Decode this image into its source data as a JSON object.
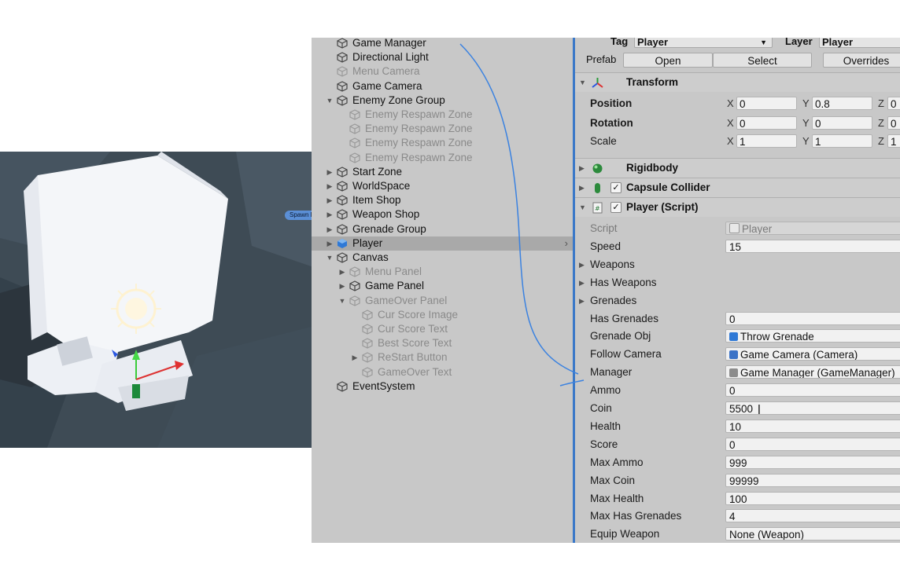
{
  "scene": {
    "spawn_label": "Spawn Po"
  },
  "hierarchy": {
    "items": [
      {
        "label": "Game Manager",
        "depth": 0,
        "arrow": "",
        "active": true
      },
      {
        "label": "Directional Light",
        "depth": 0,
        "arrow": "",
        "active": true
      },
      {
        "label": "Menu Camera",
        "depth": 0,
        "arrow": "",
        "active": false
      },
      {
        "label": "Game Camera",
        "depth": 0,
        "arrow": "",
        "active": true
      },
      {
        "label": "Enemy Zone Group",
        "depth": 0,
        "arrow": "▼",
        "active": true
      },
      {
        "label": "Enemy Respawn Zone",
        "depth": 1,
        "arrow": "",
        "active": false
      },
      {
        "label": "Enemy Respawn Zone",
        "depth": 1,
        "arrow": "",
        "active": false
      },
      {
        "label": "Enemy Respawn Zone",
        "depth": 1,
        "arrow": "",
        "active": false
      },
      {
        "label": "Enemy Respawn Zone",
        "depth": 1,
        "arrow": "",
        "active": false
      },
      {
        "label": "Start Zone",
        "depth": 0,
        "arrow": "▶",
        "active": true
      },
      {
        "label": "WorldSpace",
        "depth": 0,
        "arrow": "▶",
        "active": true
      },
      {
        "label": "Item Shop",
        "depth": 0,
        "arrow": "▶",
        "active": true
      },
      {
        "label": "Weapon Shop",
        "depth": 0,
        "arrow": "▶",
        "active": true
      },
      {
        "label": "Grenade Group",
        "depth": 0,
        "arrow": "▶",
        "active": true
      },
      {
        "label": "Player",
        "depth": 0,
        "arrow": "▶",
        "active": true,
        "selected": true
      },
      {
        "label": "Canvas",
        "depth": 0,
        "arrow": "▼",
        "active": true
      },
      {
        "label": "Menu Panel",
        "depth": 1,
        "arrow": "▶",
        "active": false
      },
      {
        "label": "Game Panel",
        "depth": 1,
        "arrow": "▶",
        "active": true
      },
      {
        "label": "GameOver Panel",
        "depth": 1,
        "arrow": "▼",
        "active": false
      },
      {
        "label": "Cur Score Image",
        "depth": 2,
        "arrow": "",
        "active": false
      },
      {
        "label": "Cur Score Text",
        "depth": 2,
        "arrow": "",
        "active": false
      },
      {
        "label": "Best Score Text",
        "depth": 2,
        "arrow": "",
        "active": false
      },
      {
        "label": "ReStart Button",
        "depth": 2,
        "arrow": "▶",
        "active": false
      },
      {
        "label": "GameOver Text",
        "depth": 2,
        "arrow": "",
        "active": false
      },
      {
        "label": "EventSystem",
        "depth": 0,
        "arrow": "",
        "active": true
      }
    ],
    "selected_chevron": "›"
  },
  "inspector": {
    "tag_label": "Tag",
    "tag_value": "Player",
    "layer_label": "Layer",
    "layer_value": "Player",
    "prefab_label": "Prefab",
    "prefab_open": "Open",
    "prefab_select": "Select",
    "prefab_overrides": "Overrides",
    "transform": {
      "title": "Transform",
      "position_label": "Position",
      "rotation_label": "Rotation",
      "scale_label": "Scale",
      "position": {
        "x": "0",
        "y": "0.8",
        "z": "0"
      },
      "rotation": {
        "x": "0",
        "y": "0",
        "z": "0"
      },
      "scale": {
        "x": "1",
        "y": "1",
        "z": "1"
      },
      "axis_x": "X",
      "axis_y": "Y",
      "axis_z": "Z"
    },
    "rigidbody_title": "Rigidbody",
    "capsule_title": "Capsule Collider",
    "player_script_title": "Player (Script)",
    "checkmark": "✓",
    "fields": [
      {
        "label": "Script",
        "value": "Player",
        "kind": "script"
      },
      {
        "label": "Speed",
        "value": "15",
        "kind": "value"
      },
      {
        "label": "Weapons",
        "value": "",
        "kind": "expand"
      },
      {
        "label": "Has Weapons",
        "value": "",
        "kind": "expand"
      },
      {
        "label": "Grenades",
        "value": "",
        "kind": "expand"
      },
      {
        "label": "Has Grenades",
        "value": "0",
        "kind": "value"
      },
      {
        "label": "Grenade Obj",
        "value": "Throw Grenade",
        "kind": "object",
        "icon_color": "#2f79d6"
      },
      {
        "label": "Follow Camera",
        "value": "Game Camera (Camera)",
        "kind": "object",
        "icon_color": "#3b73c7"
      },
      {
        "label": "Manager",
        "value": "Game Manager (GameManager)",
        "kind": "object",
        "icon_color": "#8c8c8c"
      },
      {
        "label": "Ammo",
        "value": "0",
        "kind": "value"
      },
      {
        "label": "Coin",
        "value": "5500",
        "kind": "value",
        "editing": true
      },
      {
        "label": "Health",
        "value": "10",
        "kind": "value"
      },
      {
        "label": "Score",
        "value": "0",
        "kind": "value"
      },
      {
        "label": "Max Ammo",
        "value": "999",
        "kind": "value"
      },
      {
        "label": "Max Coin",
        "value": "99999",
        "kind": "value"
      },
      {
        "label": "Max Health",
        "value": "100",
        "kind": "value"
      },
      {
        "label": "Max Has Grenades",
        "value": "4",
        "kind": "value"
      },
      {
        "label": "Equip Weapon",
        "value": "None (Weapon)",
        "kind": "value"
      }
    ]
  },
  "colors": {
    "panel_bg": "#c8c8c8",
    "selection": "#a9a9a9",
    "accent": "#3a78c8",
    "curve": "#3b82e0"
  }
}
